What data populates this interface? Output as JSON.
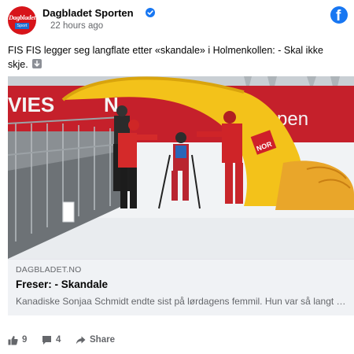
{
  "header": {
    "page_name": "Dagbladet Sporten",
    "post_time": "22 hours ago",
    "avatar_word": "Dagbladet",
    "avatar_sub": "Sport",
    "verified_icon": "verified-check-icon",
    "platform_icon": "facebook-logo-icon"
  },
  "post": {
    "message": "FIS FIS legger seg langflate etter «skandale» i Holmenkollen: - Skal ikke skje."
  },
  "photo": {
    "banner_left": "VIES",
    "banner_mid": "N",
    "banner_right": "mpen",
    "flag_text": "NOR"
  },
  "link_preview": {
    "domain": "DAGBLADET.NO",
    "title": "Freser: - Skandale",
    "description": "Kanadiske Sonjaa Schmidt endte sist på lørdagens femmil. Hun var så langt bak at arrangørene hadde begynt å rive målområdet."
  },
  "footer": {
    "likes_count": "9",
    "comments_count": "4",
    "share_label": "Share"
  },
  "colors": {
    "facebook_blue": "#1877f2",
    "brand_red": "#d7141a",
    "muted_text": "#65676b",
    "preview_bg": "#f0f2f5"
  }
}
